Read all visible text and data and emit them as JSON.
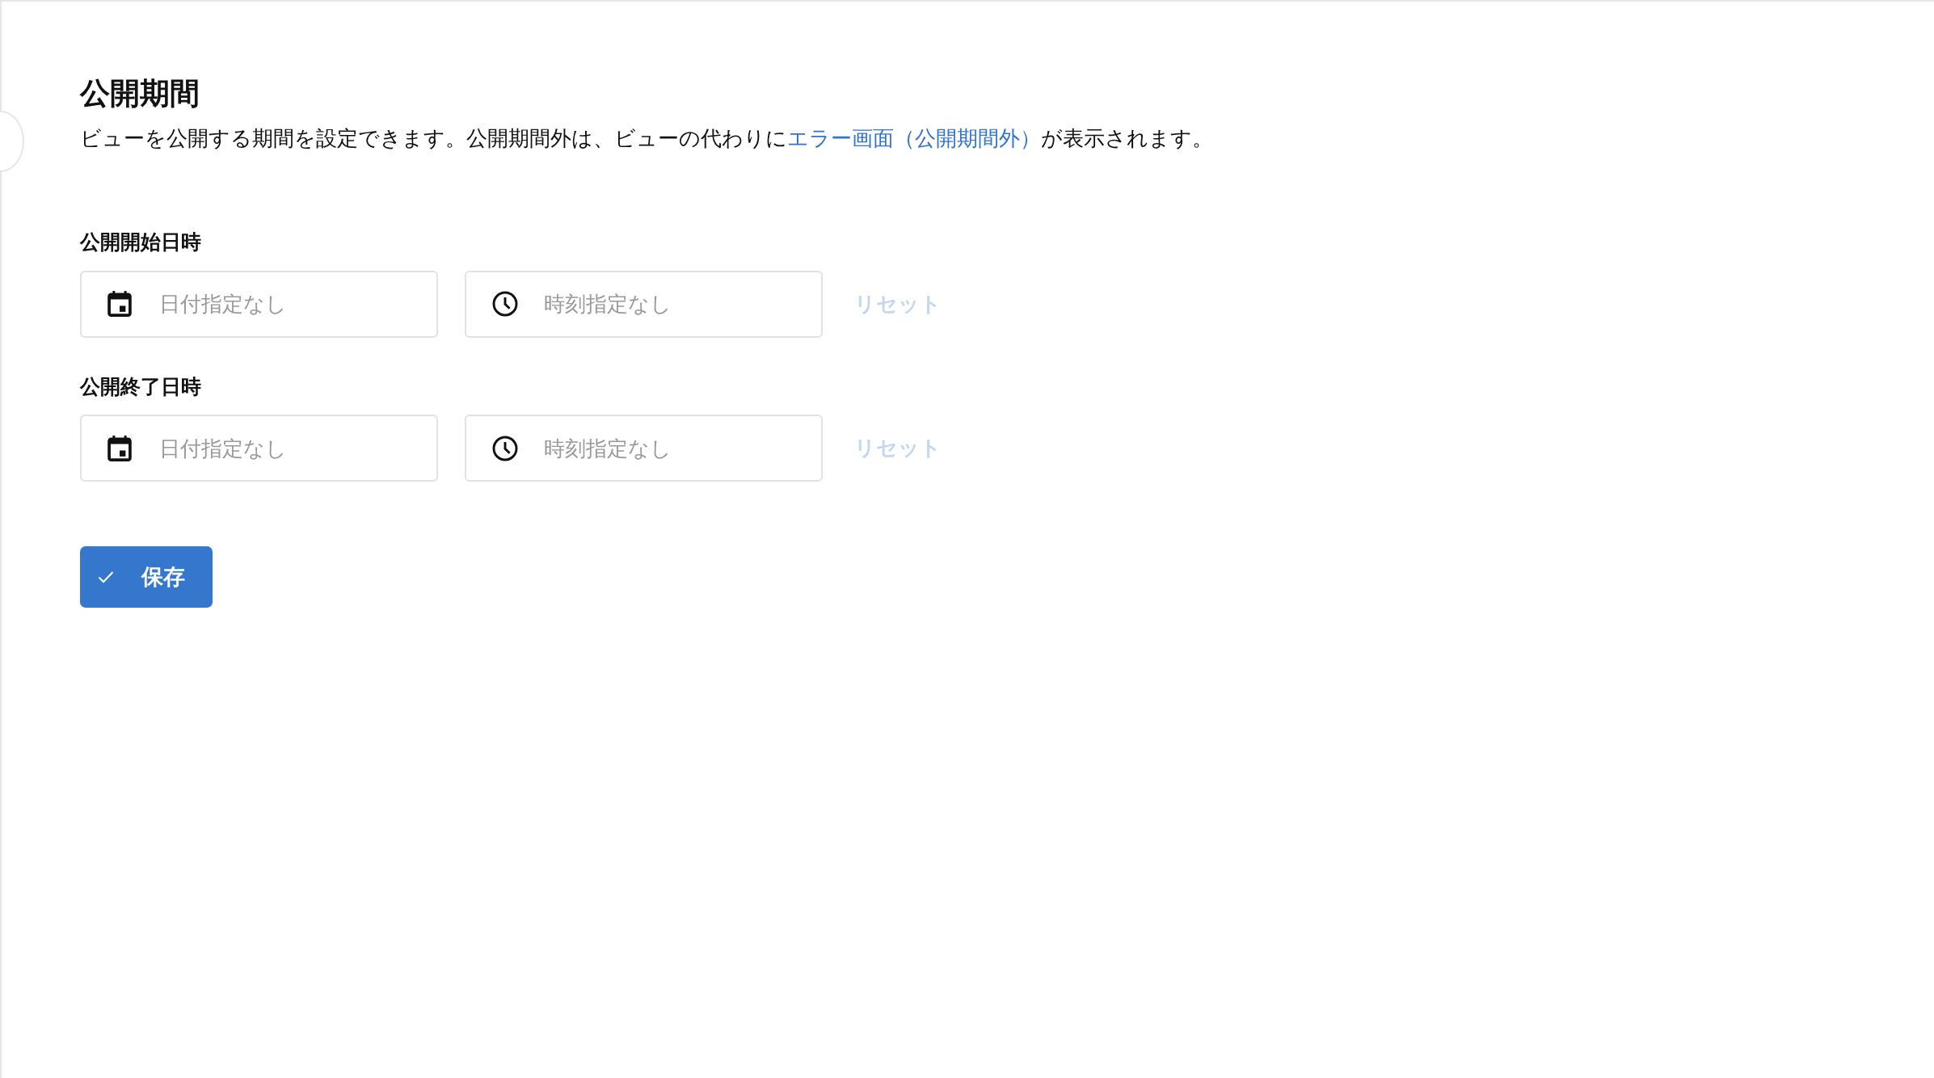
{
  "title": "公開期間",
  "description": {
    "before": "ビューを公開する期間を設定できます。公開期間外は、ビューの代わりに",
    "link": "エラー画面（公開期間外）",
    "after": "が表示されます。"
  },
  "fields": [
    {
      "label": "公開開始日時",
      "date": {
        "placeholder": "日付指定なし"
      },
      "time": {
        "placeholder": "時刻指定なし"
      },
      "reset": {
        "label": "リセット",
        "disabled": true
      }
    },
    {
      "label": "公開終了日時",
      "date": {
        "placeholder": "日付指定なし"
      },
      "time": {
        "placeholder": "時刻指定なし"
      },
      "reset": {
        "label": "リセット",
        "disabled": true
      }
    }
  ],
  "save_button": {
    "label": "保存"
  }
}
